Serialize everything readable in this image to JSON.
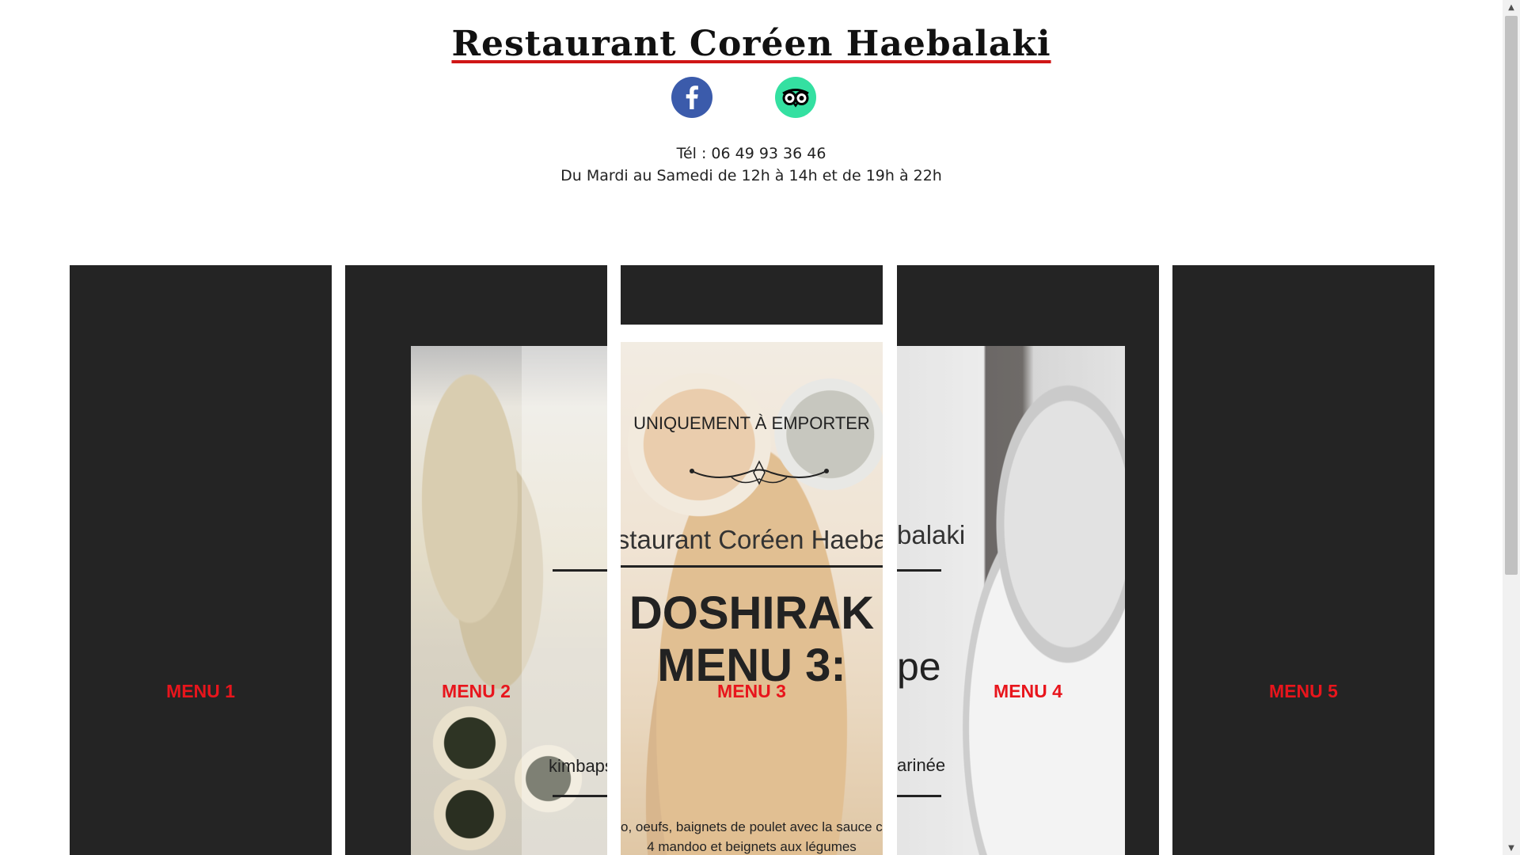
{
  "header": {
    "title": "Restaurant Coréen Haebalaki",
    "social": {
      "facebook_icon": "facebook-icon",
      "tripadvisor_icon": "tripadvisor-icon"
    },
    "phone": "Tél : 06 49 93 36 46",
    "hours": "Du Mardi au Samedi de 12h à 14h et de 19h à 22h"
  },
  "menus": [
    {
      "label": "MENU 1"
    },
    {
      "label": "MENU 2",
      "image_text": "kimbaps"
    },
    {
      "label": "MENU 3",
      "image_heading": "UNIQUEMENT À EMPORTER",
      "image_restaurant": "Restaurant Coréen Haebalaki",
      "image_title_line1": "DOSHIRAK",
      "image_title_line2": "MENU 3:",
      "image_desc_line1": "o, oeufs, baignets de poulet avec la sauce co",
      "image_desc_line2": "4 mandoo et beignets aux légumes"
    },
    {
      "label": "MENU 4",
      "image_text_name": "balaki",
      "image_text_big": "pe",
      "image_text_small": "arinée"
    },
    {
      "label": "MENU 5"
    }
  ],
  "colors": {
    "title_underline": "#d01616",
    "menu_label": "#e8151c",
    "panel_bg": "#242424",
    "facebook": "#3b5bab",
    "tripadvisor": "#34e0a1"
  }
}
